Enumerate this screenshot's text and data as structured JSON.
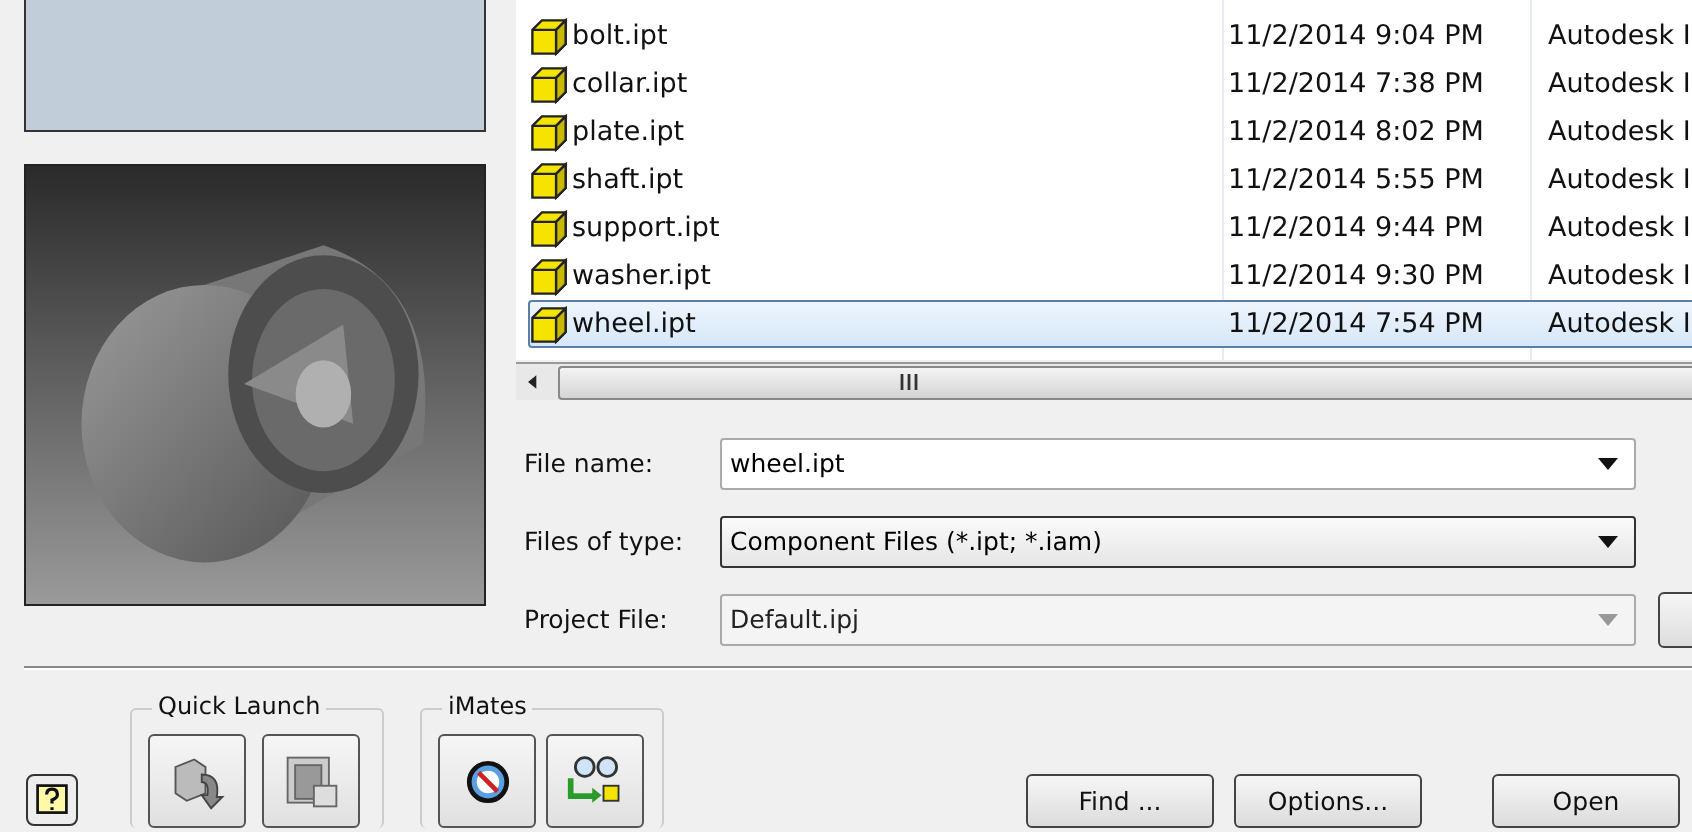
{
  "file_list": {
    "rows": [
      {
        "name": "bolt.ipt",
        "column_2": "11/2/2014 9:04 PM",
        "column_3": "Autodesk I",
        "selected": false
      },
      {
        "name": "collar.ipt",
        "column_2": "11/2/2014 7:38 PM",
        "column_3": "Autodesk I",
        "selected": false
      },
      {
        "name": "plate.ipt",
        "column_2": "11/2/2014 8:02 PM",
        "column_3": "Autodesk I",
        "selected": false
      },
      {
        "name": "shaft.ipt",
        "column_2": "11/2/2014 5:55 PM",
        "column_3": "Autodesk I",
        "selected": false
      },
      {
        "name": "support.ipt",
        "column_2": "11/2/2014 9:44 PM",
        "column_3": "Autodesk I",
        "selected": false
      },
      {
        "name": "washer.ipt",
        "column_2": "11/2/2014 9:30 PM",
        "column_3": "Autodesk I",
        "selected": false
      },
      {
        "name": "wheel.ipt",
        "column_2": "11/2/2014 7:54 PM",
        "column_3": "Autodesk I",
        "selected": true
      }
    ]
  },
  "fields": [
    {
      "label": "File name:",
      "value": "wheel.ipt",
      "kind": "editable",
      "disabled": false
    },
    {
      "label": "Files of type:",
      "value": "Component Files (*.ipt; *.iam)",
      "kind": "list",
      "disabled": false
    },
    {
      "label": "Project File:",
      "value": "Default.ipj",
      "kind": "list",
      "disabled": true
    }
  ],
  "groups": [
    {
      "title": "Quick Launch",
      "kind": "quick_launch"
    },
    {
      "title": "iMates",
      "kind": "imates"
    }
  ],
  "buttons": [
    "Find ...",
    "Options...",
    "Open"
  ]
}
